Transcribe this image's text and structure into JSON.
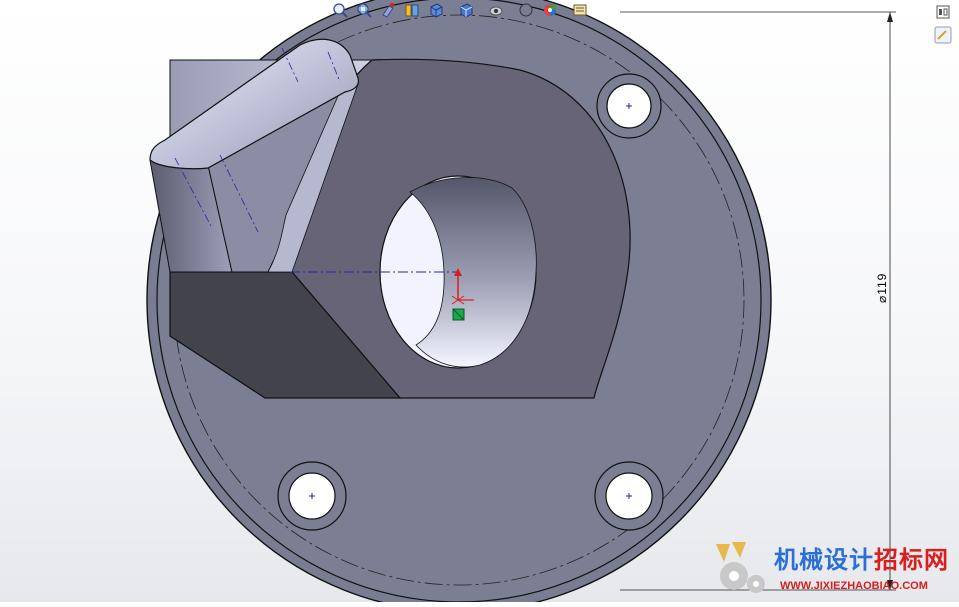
{
  "colors": {
    "part_face": "#7a7d92",
    "pocket_face": "#676478",
    "dark_face": "#42434c",
    "accent_red": "#d81e1e",
    "accent_blue": "#2c6fd6"
  },
  "toolbar": {
    "items": [
      {
        "name": "zoom-to-fit-icon"
      },
      {
        "name": "zoom-to-area-icon"
      },
      {
        "name": "previous-view-icon"
      },
      {
        "name": "section-view-icon"
      },
      {
        "name": "view-orientation-icon"
      },
      {
        "name": "display-style-icon"
      },
      {
        "name": "hide-show-items-icon"
      },
      {
        "name": "edit-appearance-icon"
      },
      {
        "name": "apply-scene-icon"
      },
      {
        "name": "view-settings-icon"
      }
    ]
  },
  "dimension": {
    "label": "⌀119"
  },
  "watermark": {
    "title_part1": "机械设计",
    "title_part2": "招标网",
    "url": "WWW.JIXIEZHAOBIAO.COM"
  }
}
